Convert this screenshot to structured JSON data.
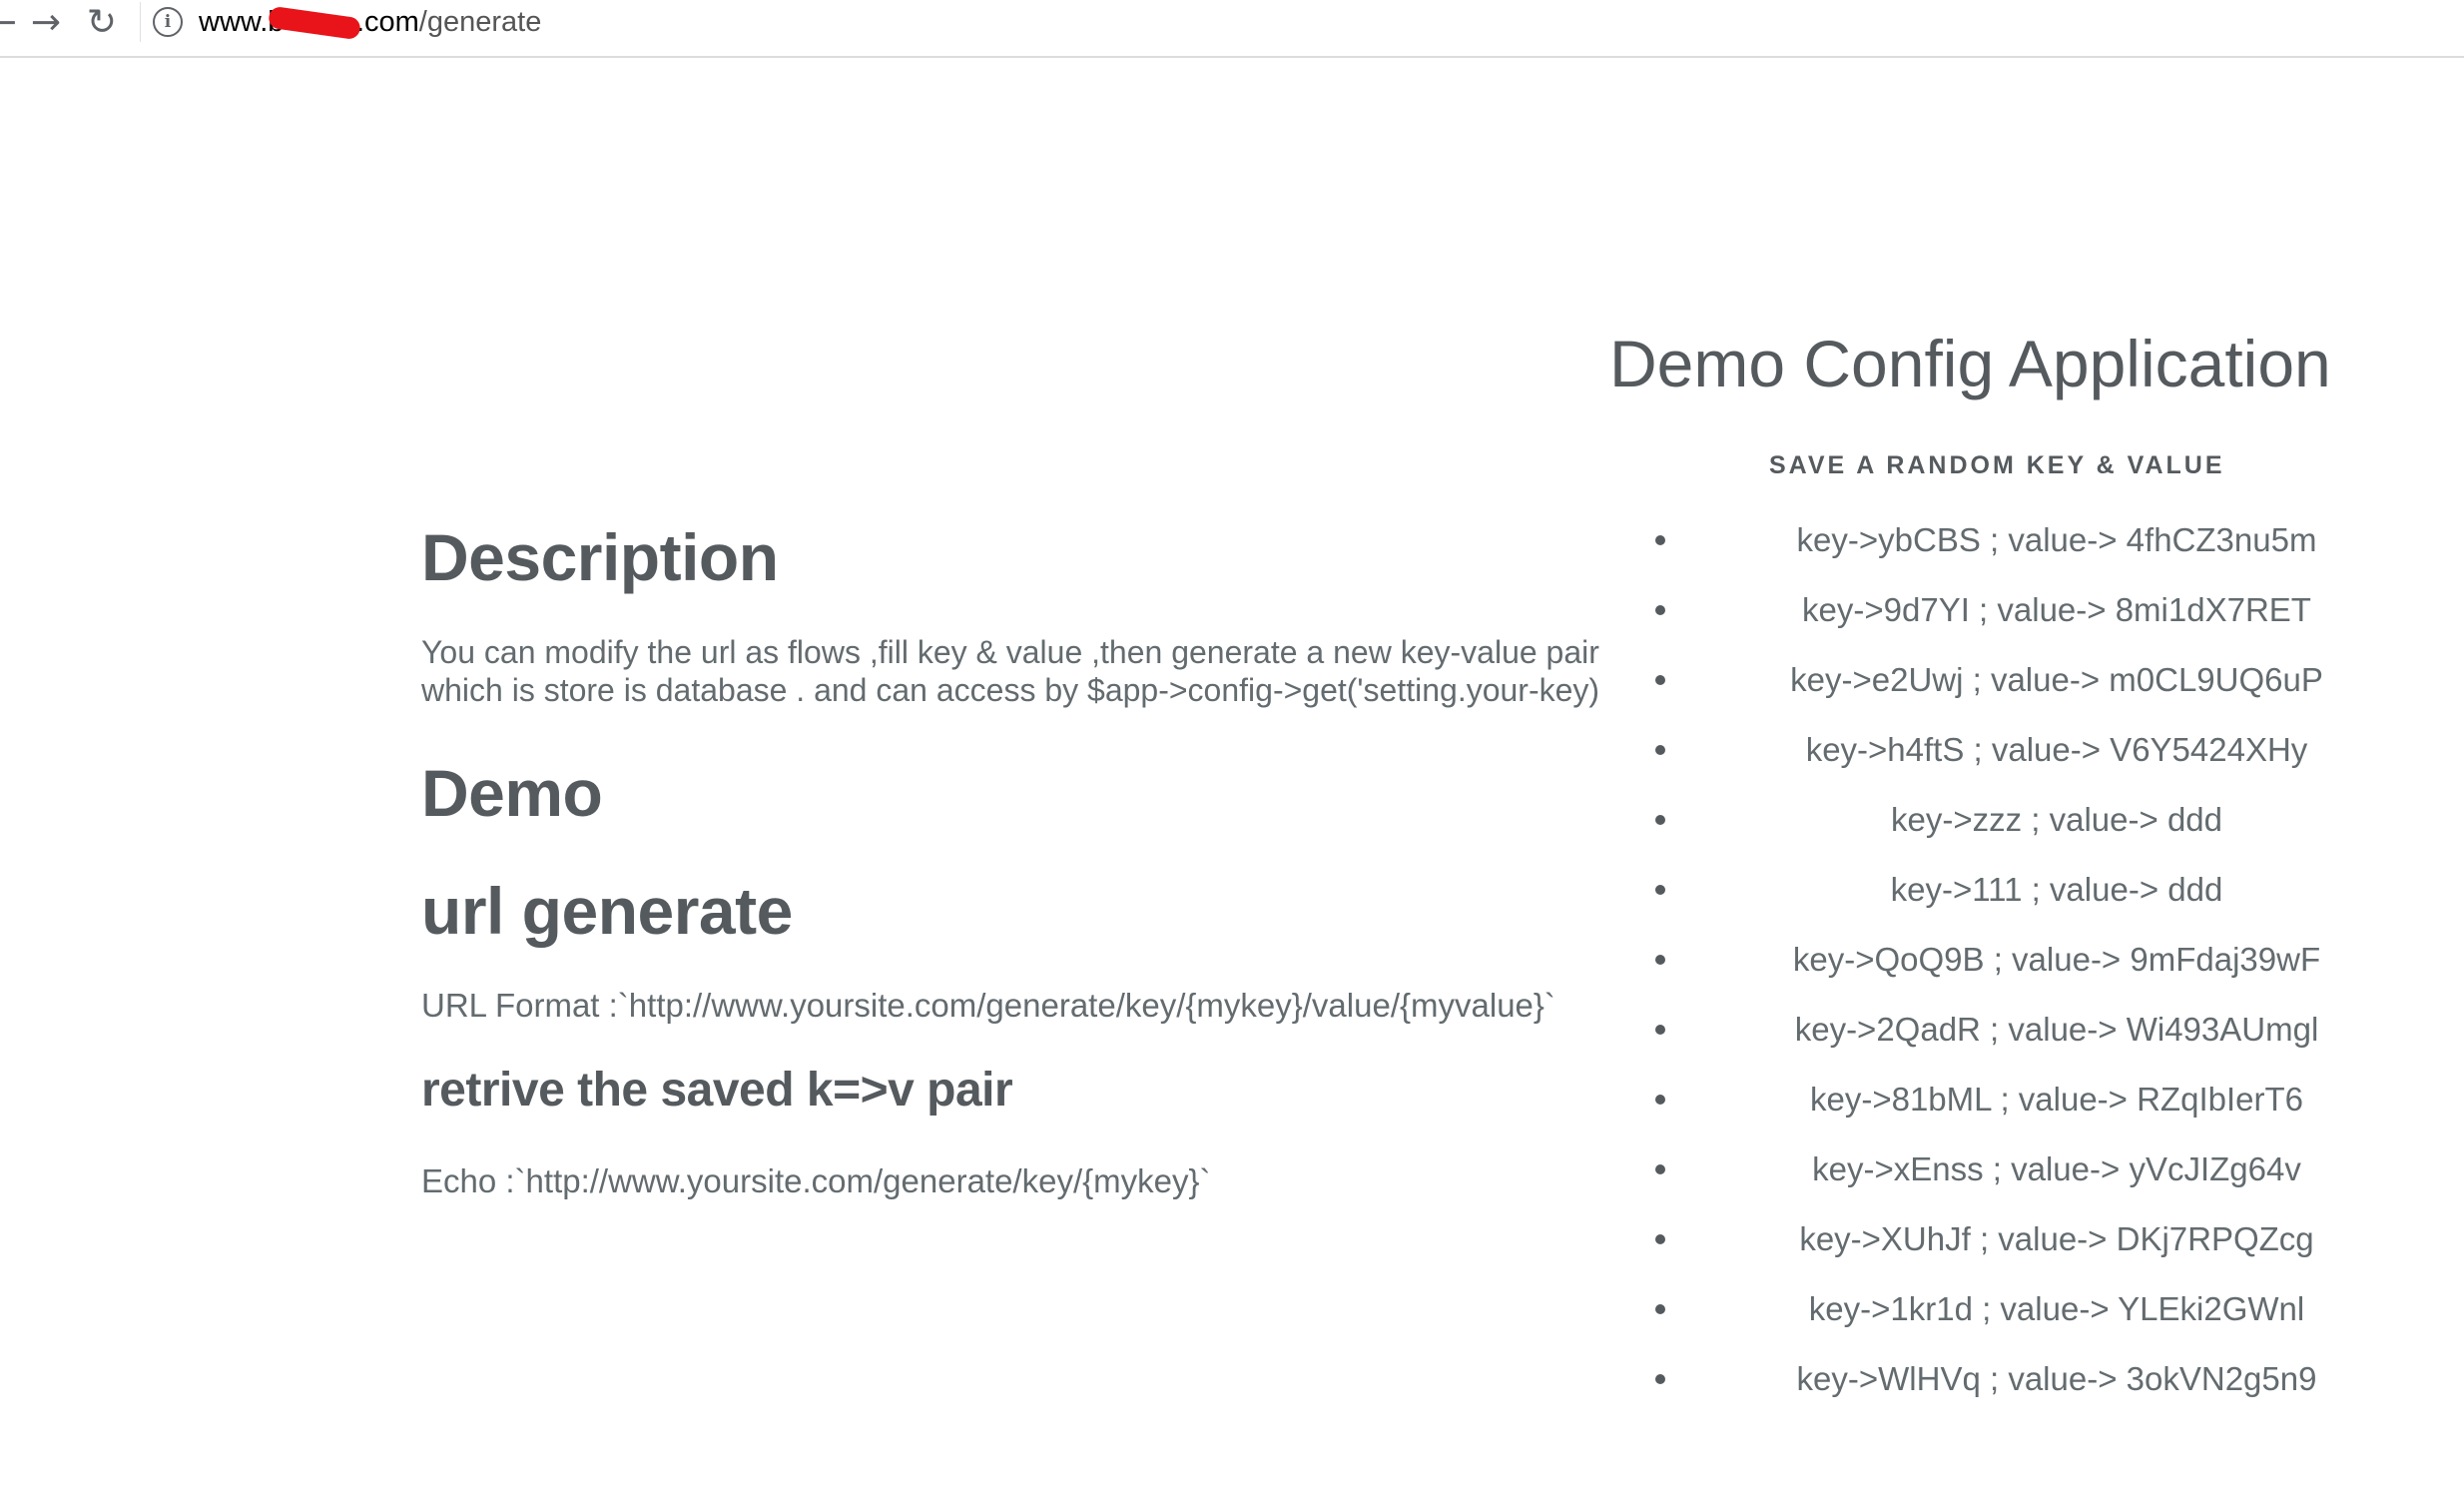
{
  "browser": {
    "url_prefix": "www.b",
    "url_hidden": "         ",
    "url_domain_end": "com",
    "url_path": "/generate"
  },
  "left": {
    "description_heading": "Description",
    "description_text": "You can modify the url as flows ,fill key & value ,then generate a new key-value pair which is store is database . and can access by $app->config->get('setting.your-key)",
    "demo_heading": "Demo",
    "url_generate_heading": "url generate",
    "url_format": "URL Format :`http://www.yoursite.com/generate/key/{mykey}/value/{myvalue}`",
    "retrieve_heading": "retrive the saved k=>v pair",
    "echo_text": "Echo :`http://www.yoursite.com/generate/key/{mykey}`"
  },
  "right": {
    "title": "Demo Config Application",
    "section_label": "SAVE A RANDOM KEY & VALUE",
    "items": [
      "key->ybCBS ; value-> 4fhCZ3nu5m",
      "key->9d7YI ; value-> 8mi1dX7RET",
      "key->e2Uwj ; value-> m0CL9UQ6uP",
      "key->h4ftS ; value-> V6Y5424XHy",
      "key->zzz ; value-> ddd",
      "key->111 ; value-> ddd",
      "key->QoQ9B ; value-> 9mFdaj39wF",
      "key->2QadR ; value-> Wi493AUmgl",
      "key->81bML ; value-> RZqIbIerT6",
      "key->xEnss ; value-> yVcJIZg64v",
      "key->XUhJf ; value-> DKj7RPQZcg",
      "key->1kr1d ; value-> YLEki2GWnl",
      "key->WlHVq ; value-> 3okVN2g5n9"
    ]
  }
}
